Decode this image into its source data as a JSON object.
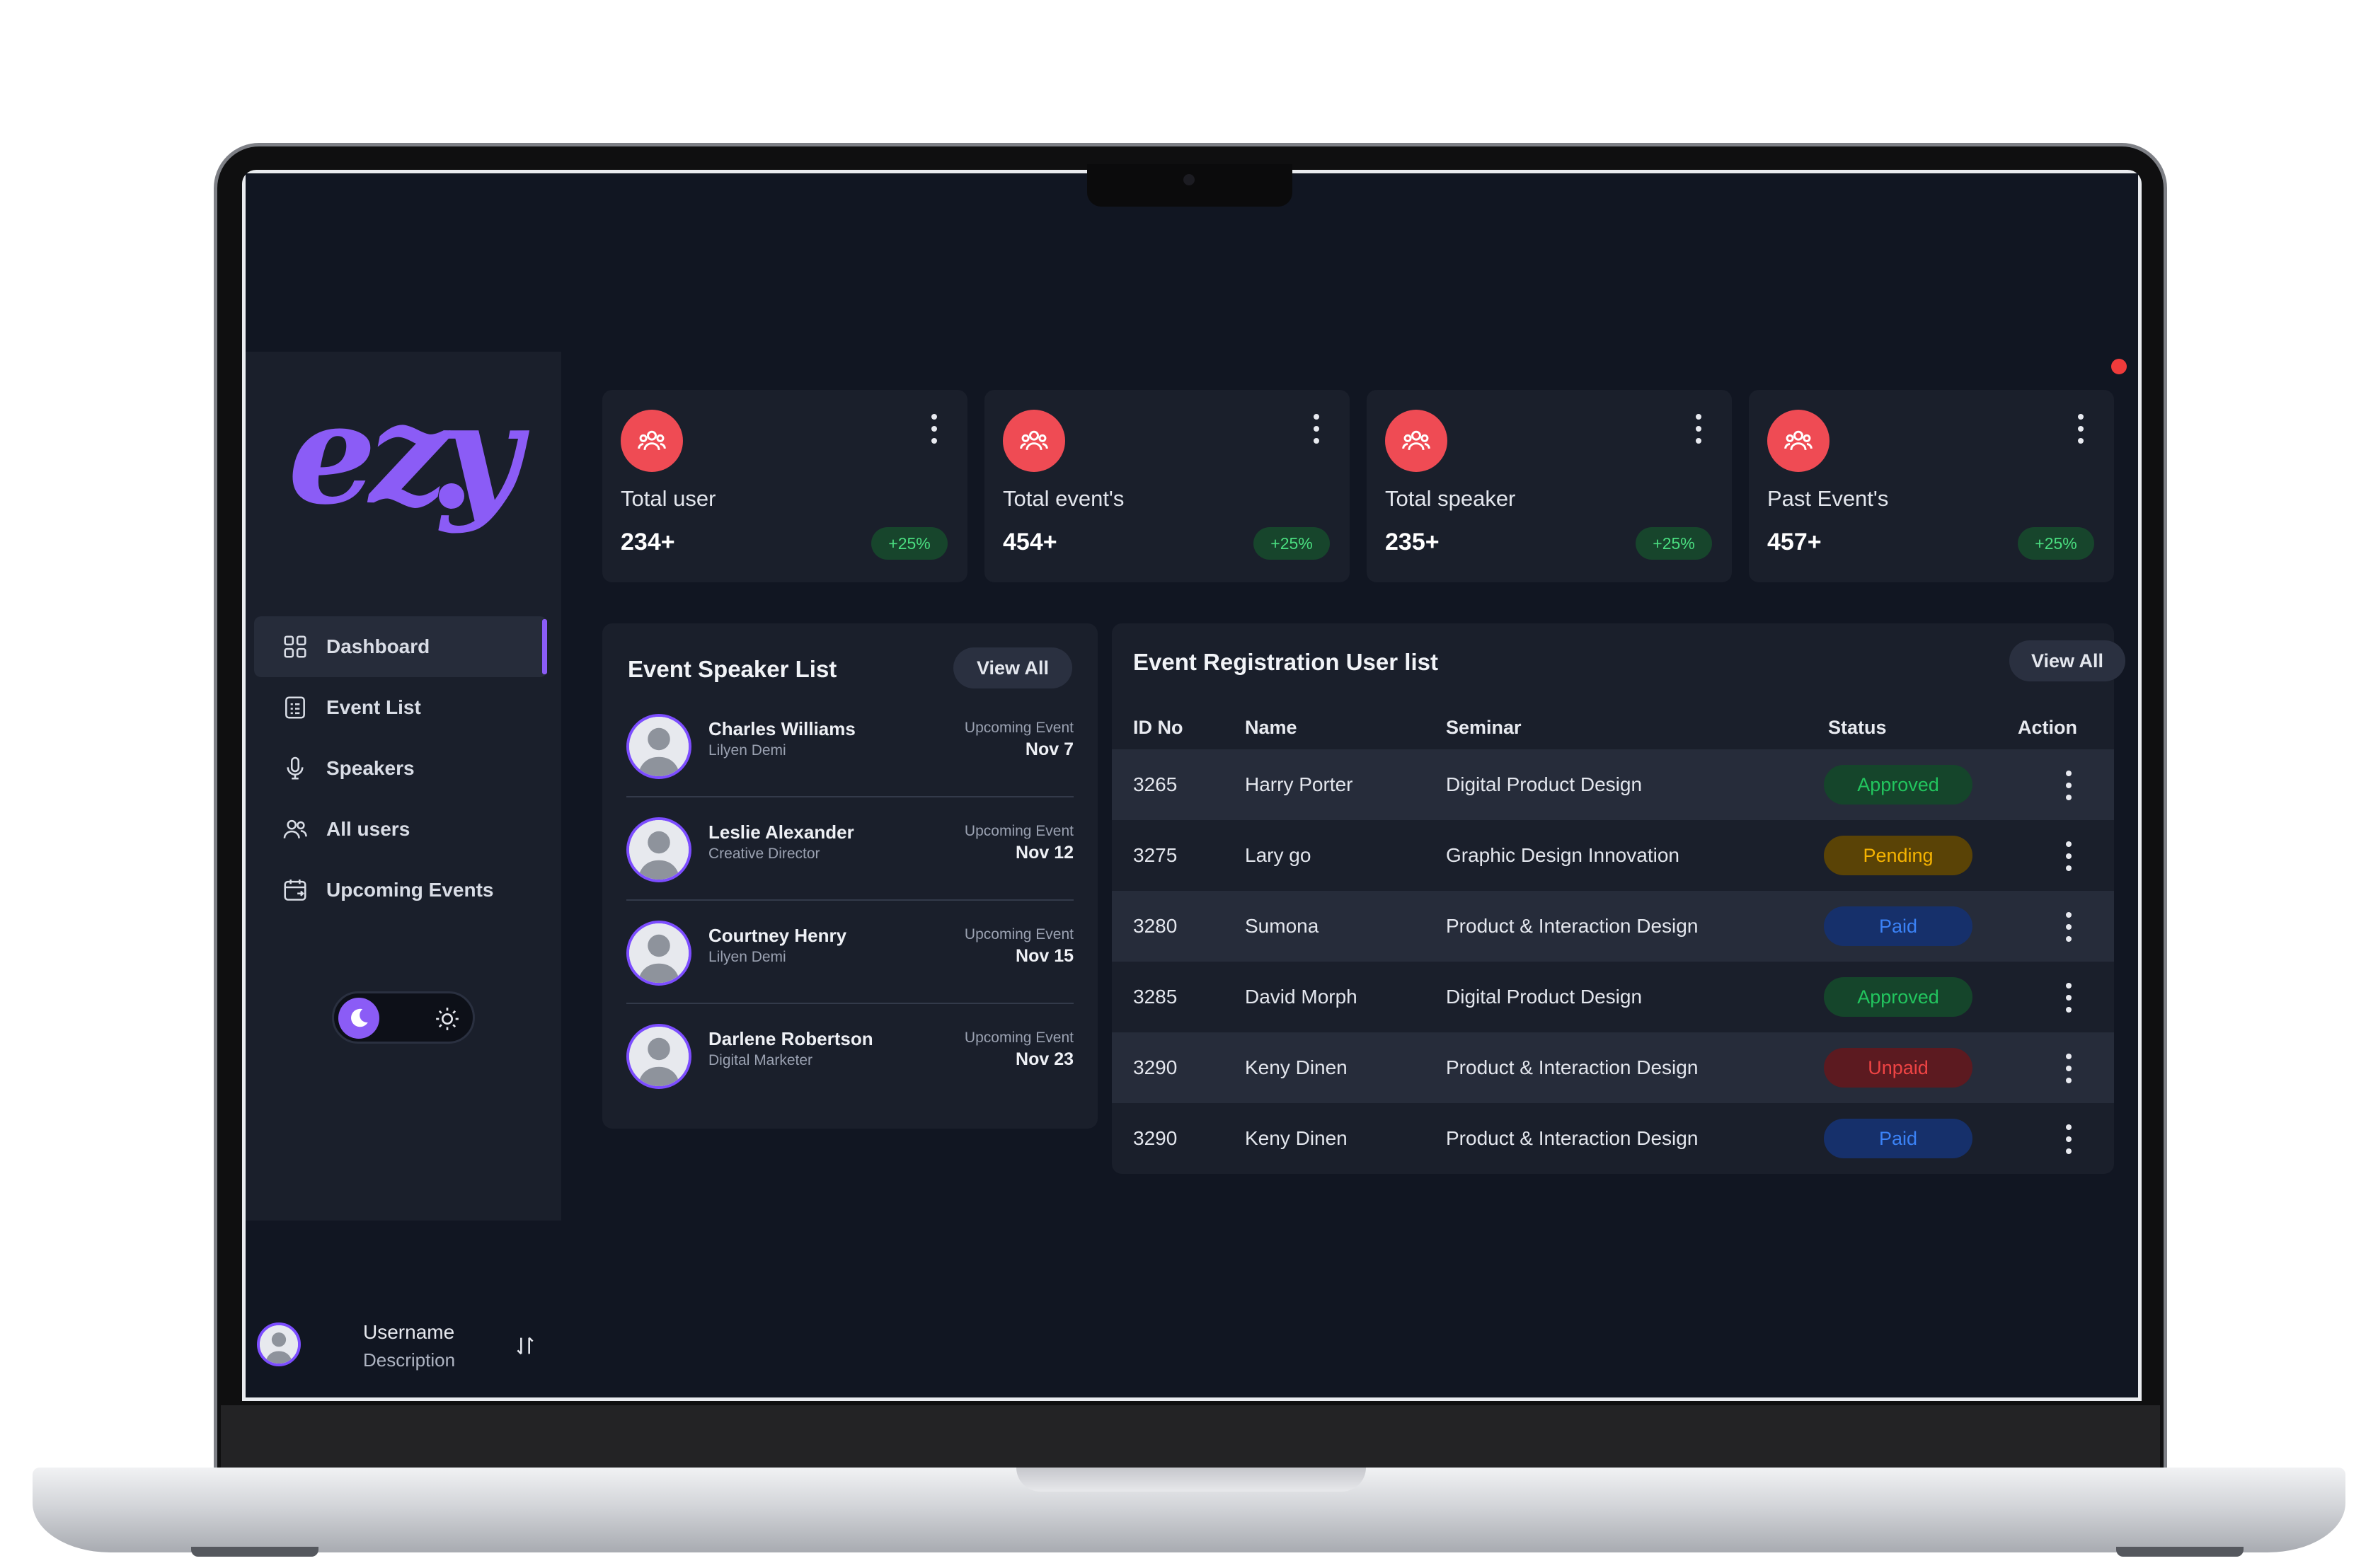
{
  "brand": {
    "logo_text": "ezy",
    "accent": "#8b5cf6",
    "background": "#111622",
    "panel": "#1a1f2b"
  },
  "sidebar": {
    "items": [
      {
        "label": "Dashboard",
        "icon": "dashboard-grid-icon",
        "active": true
      },
      {
        "label": "Event List",
        "icon": "clipboard-list-icon",
        "active": false
      },
      {
        "label": "Speakers",
        "icon": "microphone-icon",
        "active": false
      },
      {
        "label": "All users",
        "icon": "users-icon",
        "active": false
      },
      {
        "label": "Upcoming Events",
        "icon": "calendar-icon",
        "active": false
      }
    ],
    "theme_toggle": {
      "selected": "dark",
      "options": [
        "moon-icon",
        "sun-icon"
      ]
    },
    "user": {
      "name": "Username",
      "description": "Description",
      "icon": "sort-arrows-icon"
    }
  },
  "stats": [
    {
      "label": "Total user",
      "value": "234+",
      "change": "+25%",
      "icon": "users-icon"
    },
    {
      "label": "Total event's",
      "value": "454+",
      "change": "+25%",
      "icon": "users-icon"
    },
    {
      "label": "Total speaker",
      "value": "235+",
      "change": "+25%",
      "icon": "users-icon"
    },
    {
      "label": "Past Event's",
      "value": "457+",
      "change": "+25%",
      "icon": "users-icon"
    }
  ],
  "speakers_panel": {
    "title": "Event Speaker List",
    "view_all": "View All",
    "items": [
      {
        "name": "Charles Williams",
        "role": "Lilyen Demi",
        "tag": "Upcoming Event",
        "date": "Nov 7"
      },
      {
        "name": "Leslie Alexander",
        "role": "Creative Director",
        "tag": "Upcoming Event",
        "date": "Nov 12"
      },
      {
        "name": "Courtney Henry",
        "role": "Lilyen Demi",
        "tag": "Upcoming Event",
        "date": "Nov 15"
      },
      {
        "name": "Darlene Robertson",
        "role": "Digital Marketer",
        "tag": "Upcoming Event",
        "date": "Nov 23"
      }
    ]
  },
  "registration_panel": {
    "title": "Event Registration User list",
    "view_all": "View All",
    "columns": [
      "ID No",
      "Name",
      "Seminar",
      "Status",
      "Action"
    ],
    "rows": [
      {
        "id": "3265",
        "name": "Harry Porter",
        "seminar": "Digital Product Design",
        "status": "Approved",
        "status_color": "#22c55e"
      },
      {
        "id": "3275",
        "name": "Lary go",
        "seminar": "Graphic Design Innovation",
        "status": "Pending",
        "status_color": "#f5b301"
      },
      {
        "id": "3280",
        "name": "Sumona",
        "seminar": "Product & Interaction Design",
        "status": "Paid",
        "status_color": "#3b82f6"
      },
      {
        "id": "3285",
        "name": "David Morph",
        "seminar": "Digital Product Design",
        "status": "Approved",
        "status_color": "#22c55e"
      },
      {
        "id": "3290",
        "name": "Keny Dinen",
        "seminar": "Product & Interaction Design",
        "status": "Unpaid",
        "status_color": "#ef4444"
      },
      {
        "id": "3290",
        "name": "Keny Dinen",
        "seminar": "Product & Interaction Design",
        "status": "Paid",
        "status_color": "#3b82f6"
      }
    ]
  }
}
